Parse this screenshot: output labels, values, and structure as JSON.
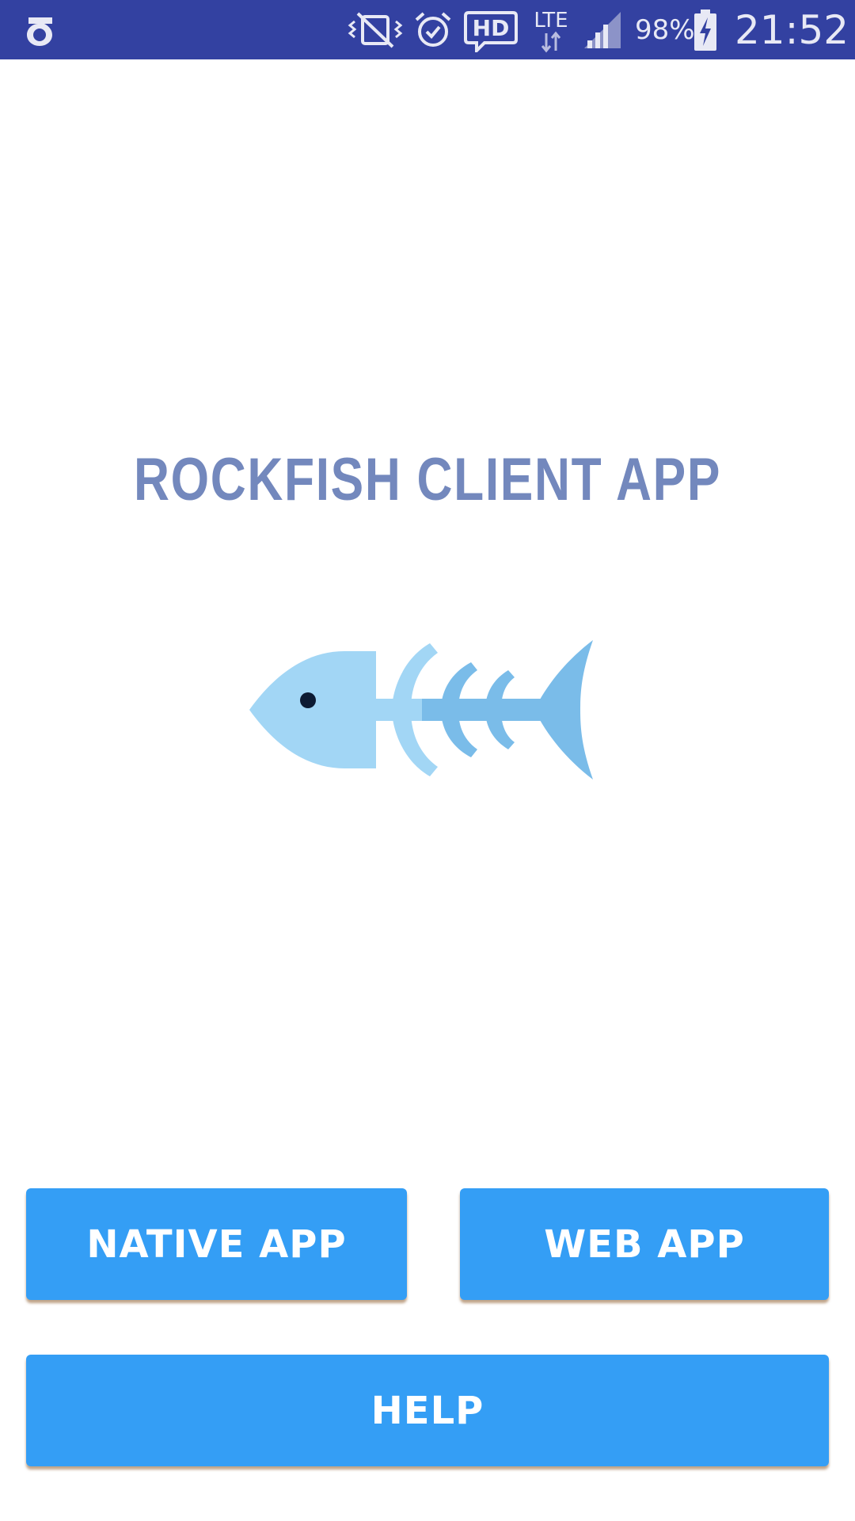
{
  "status_bar": {
    "background": "#3341a1",
    "icons": [
      "app-logo-icon",
      "vibrate-mute-icon",
      "alarm-icon",
      "hd-voice-icon",
      "lte-data-icon",
      "signal-icon",
      "battery-charging-icon"
    ],
    "hd_label": "HD",
    "lte_label": "LTE",
    "battery_percent": "98%",
    "time": "21:52"
  },
  "main": {
    "title": "ROCKFISH CLIENT APP",
    "title_color": "#7388bd",
    "logo_icon": "fish-skeleton-icon",
    "logo_colors": {
      "light": "#a2d6f5",
      "mid": "#7abce9",
      "eye": "#0d1b33"
    }
  },
  "buttons": {
    "color": "#349ef5",
    "native_app": "NATIVE APP",
    "web_app": "WEB APP",
    "help": "HELP"
  }
}
